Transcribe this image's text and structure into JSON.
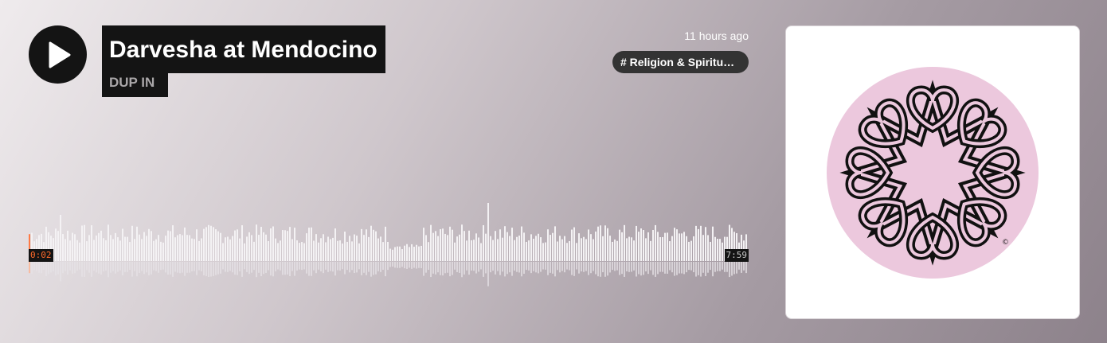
{
  "track": {
    "title": "Darvesha at Mendocino",
    "artist": "DUP IN",
    "posted": "11 hours ago",
    "tag": "# Religion & Spiritu…"
  },
  "player": {
    "current_time": "0:02",
    "duration": "7:59",
    "progress": 0.004
  },
  "artwork": {
    "copyright_mark": "©"
  },
  "colors": {
    "accent": "#ff5500",
    "dark": "#141414",
    "artwork_bg": "#ecc8dd"
  },
  "icons": {
    "play": "play-icon"
  }
}
